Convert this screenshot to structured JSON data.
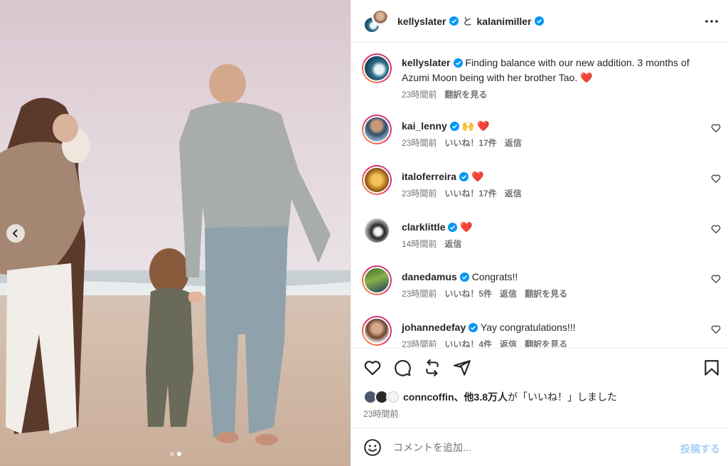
{
  "header": {
    "user1": "kellyslater",
    "conjunction": "と",
    "user2": "kalanimiller",
    "more_icon": "more-horizontal-icon"
  },
  "caption": {
    "username": "kellyslater",
    "text": "Finding balance with our new addition. 3 months of Azumi Moon being with her brother Tao. ❤️",
    "time": "23時間前",
    "translate": "翻訳を見る"
  },
  "comments": [
    {
      "username": "kai_lenny",
      "text": "🙌 ❤️",
      "time": "23時間前",
      "likes": "いいね！17件",
      "reply": "返信",
      "translate": ""
    },
    {
      "username": "italoferreira",
      "text": "❤️",
      "time": "23時間前",
      "likes": "いいね！17件",
      "reply": "返信",
      "translate": ""
    },
    {
      "username": "clarklittle",
      "text": "❤️",
      "time": "14時間前",
      "likes": "",
      "reply": "返信",
      "translate": ""
    },
    {
      "username": "danedamus",
      "text": "Congrats!!",
      "time": "23時間前",
      "likes": "いいね！5件",
      "reply": "返信",
      "translate": "翻訳を見る"
    },
    {
      "username": "johannedefay",
      "text": "Yay congratulations!!!",
      "time": "23時間前",
      "likes": "いいね！4件",
      "reply": "返信",
      "translate": "翻訳を見る"
    }
  ],
  "actions": {
    "like_icon": "heart-icon",
    "comment_icon": "comment-icon",
    "repost_icon": "repost-icon",
    "share_icon": "send-icon",
    "save_icon": "bookmark-icon"
  },
  "likes": {
    "user": "conncoffin、",
    "rest": "他3.8万人",
    "suffix": "が「いいね！」しました",
    "posted": "23時間前"
  },
  "comment_box": {
    "placeholder": "コメントを追加...",
    "post_label": "投稿する"
  },
  "carousel": {
    "current": 2,
    "total": 2
  },
  "colors": {
    "verified": "#0095f6",
    "heart": "#ed4956",
    "link": "#0095f6"
  }
}
